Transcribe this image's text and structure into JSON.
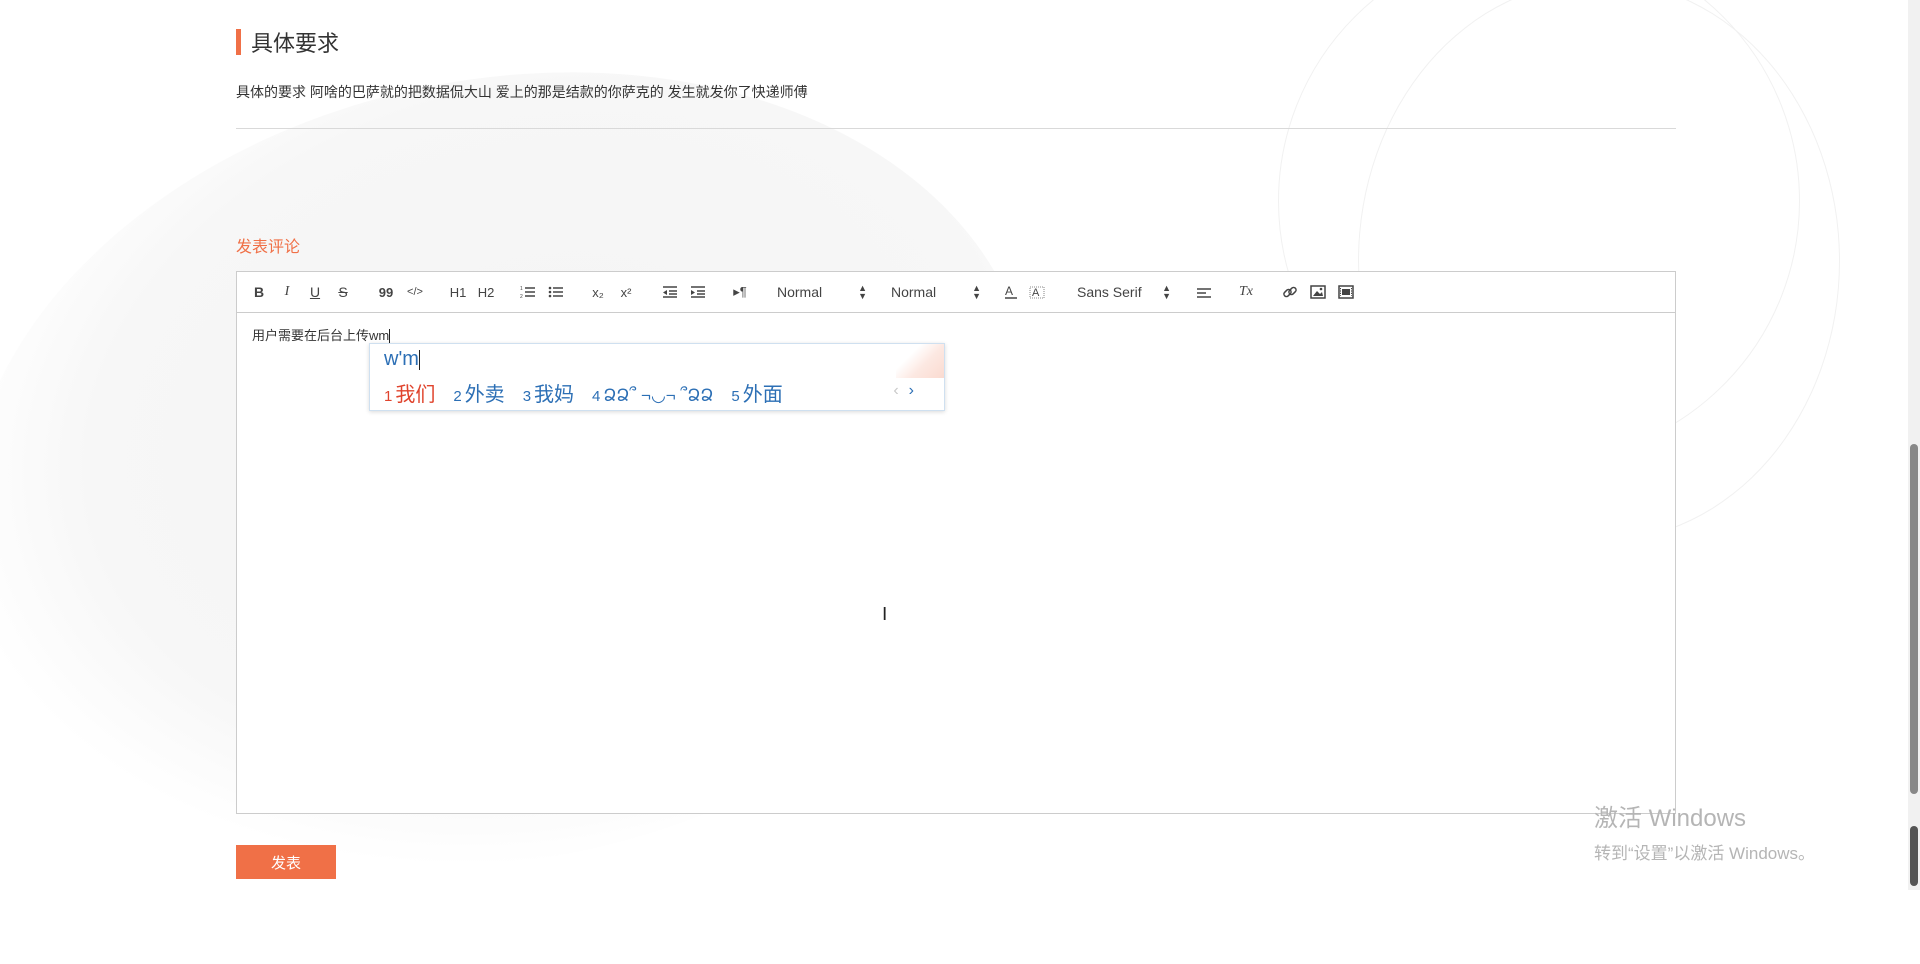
{
  "section": {
    "title": "具体要求",
    "description": "具体的要求 阿啥的巴萨就的把数据侃大山 爱上的那是结款的你萨克的 发生就发你了快递师傅",
    "accent_color": "#f07047"
  },
  "comment": {
    "label": "发表评论",
    "submit_label": "发表"
  },
  "toolbar": {
    "bold": "B",
    "italic": "I",
    "underline": "U",
    "strike": "S",
    "blockquote": "99",
    "code": "</>",
    "h1": "H1",
    "h2": "H2",
    "subscript": "x₂",
    "superscript": "x²",
    "header_select": "Normal",
    "size_select": "Normal",
    "font_select": "Sans Serif",
    "clean": "Tx"
  },
  "editor": {
    "content": "用户需要在后台上传wm"
  },
  "ime": {
    "input": "w'm",
    "candidates": [
      {
        "num": "1",
        "text": "我们"
      },
      {
        "num": "2",
        "text": "外卖"
      },
      {
        "num": "3",
        "text": "我妈"
      },
      {
        "num": "4",
        "text": "ՁՁ՞ ¬◡¬ ՞ՁՁ"
      },
      {
        "num": "5",
        "text": "外面"
      }
    ],
    "prev": "‹",
    "next": "›"
  },
  "watermark": {
    "line1": "激活 Windows",
    "line2": "转到“设置”以激活 Windows。"
  },
  "icons": {
    "list_ordered": "ordered-list-icon",
    "list_bullet": "bullet-list-icon",
    "indent": "indent-icon",
    "outdent": "outdent-icon",
    "direction": "text-direction-icon",
    "color": "font-color-icon",
    "background": "background-color-icon",
    "align": "align-icon",
    "link": "link-icon",
    "image": "image-icon",
    "video": "video-icon"
  }
}
